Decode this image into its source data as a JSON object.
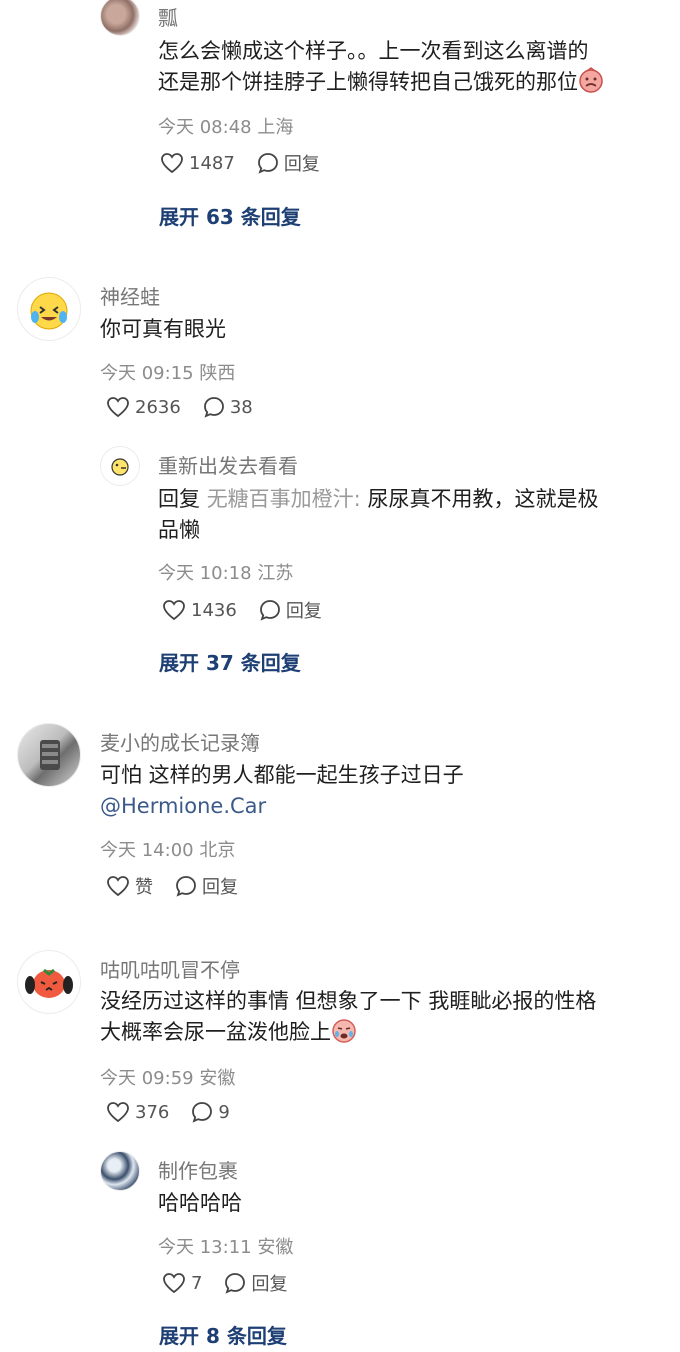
{
  "comments": [
    {
      "name": "瓢",
      "text": "怎么会懒成这个样子。。上一次看到这么离谱的还是那个饼挂脖子上懒得转把自己饿死的那位",
      "text_line1": "怎么会懒成这个样子。。上一次看到这么离谱的",
      "text_line2": "还是那个饼挂脖子上懒得转把自己饿死的那位",
      "meta": "今天 08:48 上海",
      "likes": "1487",
      "reply_label": "回复",
      "expand": "展开 63 条回复"
    },
    {
      "name": "神经蛙",
      "text": "你可真有眼光",
      "meta": "今天 09:15 陕西",
      "likes": "2636",
      "replies": "38"
    },
    {
      "name": "重新出发去看看",
      "reply_prefix": "回复",
      "quote": "无糖百事加橙汁:",
      "text_line1": " 尿尿真不用教，这就是极",
      "text_line2": "品懒",
      "meta": "今天 10:18 江苏",
      "likes": "1436",
      "reply_label": "回复",
      "expand": "展开 37 条回复"
    },
    {
      "name": "麦小的成长记录簿",
      "text": "可怕 这样的男人都能一起生孩子过日子",
      "mention": "@Hermione.Car",
      "meta": "今天 14:00 北京",
      "likes": "赞",
      "reply_label": "回复"
    },
    {
      "name": "咕叽咕叽冒不停",
      "text_line1": "没经历过这样的事情 但想象了一下 我睚眦必报的性格",
      "text_line2": "大概率会尿一盆泼他脸上",
      "meta": "今天 09:59 安徽",
      "likes": "376",
      "replies": "9"
    },
    {
      "name": "制作包裹",
      "text": "哈哈哈哈",
      "meta": "今天 13:11 安徽",
      "likes": "7",
      "reply_label": "回复",
      "expand": "展开 8 条回复"
    }
  ],
  "colors": {
    "expand": "#1d3f74",
    "meta": "#8c8c8c",
    "name": "#777777"
  },
  "icons": [
    "heart-icon",
    "comment-icon",
    "sad-emoji-icon",
    "crying-emoji-icon"
  ]
}
